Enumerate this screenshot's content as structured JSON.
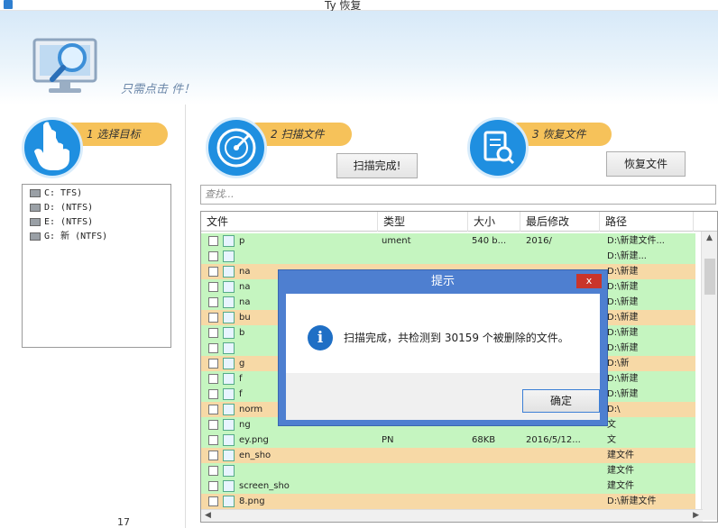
{
  "window": {
    "title": "Ty 恢复"
  },
  "header": {
    "subtitle": "只需点击 件！"
  },
  "steps": [
    {
      "label": "1 选择目标",
      "icon": "hand-pointer-icon"
    },
    {
      "label": "2 扫描文件",
      "icon": "radar-icon"
    },
    {
      "label": "3 恢复文件",
      "icon": "document-search-icon"
    }
  ],
  "drives": [
    {
      "text": "C: TFS)"
    },
    {
      "text": "D: (NTFS)"
    },
    {
      "text": "E: (NTFS)"
    },
    {
      "text": "G: 新 (NTFS)"
    }
  ],
  "buttons": {
    "scan_done": "扫描完成!",
    "recover": "恢复文件"
  },
  "search": {
    "placeholder": "查找..."
  },
  "table": {
    "columns": [
      "文件",
      "类型",
      "大小",
      "最后修改",
      "路径"
    ],
    "rows": [
      {
        "name": "p",
        "type": "ument",
        "size": "540 b...",
        "date": "2016/",
        "path": "D:\\新建文件..."
      },
      {
        "name": "",
        "type": "",
        "size": "",
        "date": "",
        "path": "D:\\新建..."
      },
      {
        "name": "na",
        "type": "",
        "size": "",
        "date": "",
        "path": "D:\\新建"
      },
      {
        "name": "na",
        "type": "",
        "size": "",
        "date": "",
        "path": "D:\\新建"
      },
      {
        "name": "na",
        "type": "",
        "size": "",
        "date": "",
        "path": "D:\\新建"
      },
      {
        "name": "bu",
        "type": "",
        "size": "",
        "date": "",
        "path": "D:\\新建"
      },
      {
        "name": "b",
        "type": "",
        "size": "",
        "date": "",
        "path": "D:\\新建"
      },
      {
        "name": "",
        "type": "",
        "size": "",
        "date": "",
        "path": "D:\\新建"
      },
      {
        "name": "g",
        "type": "",
        "size": "",
        "date": "",
        "path": "D:\\新"
      },
      {
        "name": "f",
        "type": "",
        "size": "",
        "date": "",
        "path": "D:\\新建"
      },
      {
        "name": "f",
        "type": "",
        "size": "",
        "date": "",
        "path": "D:\\新建"
      },
      {
        "name": "norm",
        "type": "",
        "size": "",
        "date": "",
        "path": "D:\\"
      },
      {
        "name": "ng",
        "type": "",
        "size": "",
        "date": "",
        "path": "文"
      },
      {
        "name": "ey.png",
        "type": "PN",
        "size": "68KB",
        "date": "2016/5/12...",
        "path": "文"
      },
      {
        "name": "en_sho",
        "type": "",
        "size": "",
        "date": "",
        "path": "建文件"
      },
      {
        "name": "",
        "type": "",
        "size": "",
        "date": "",
        "path": "建文件"
      },
      {
        "name": "screen_sho",
        "type": "",
        "size": "",
        "date": "",
        "path": "建文件"
      },
      {
        "name": "8.png",
        "type": "",
        "size": "",
        "date": "",
        "path": "D:\\新建文件"
      }
    ]
  },
  "dialog": {
    "title": "提示",
    "close_label": "x",
    "message": "扫描完成，共检测到 30159 个被删除的文件。",
    "ok_label": "确定"
  },
  "footer": {
    "version": "17"
  },
  "colors": {
    "accent_blue": "#1f8fe0",
    "step_pill": "#f6c25a",
    "dialog_frame": "#4e7fd0",
    "row_green": "#c5f5c0",
    "row_orange": "#f7d9a6"
  }
}
